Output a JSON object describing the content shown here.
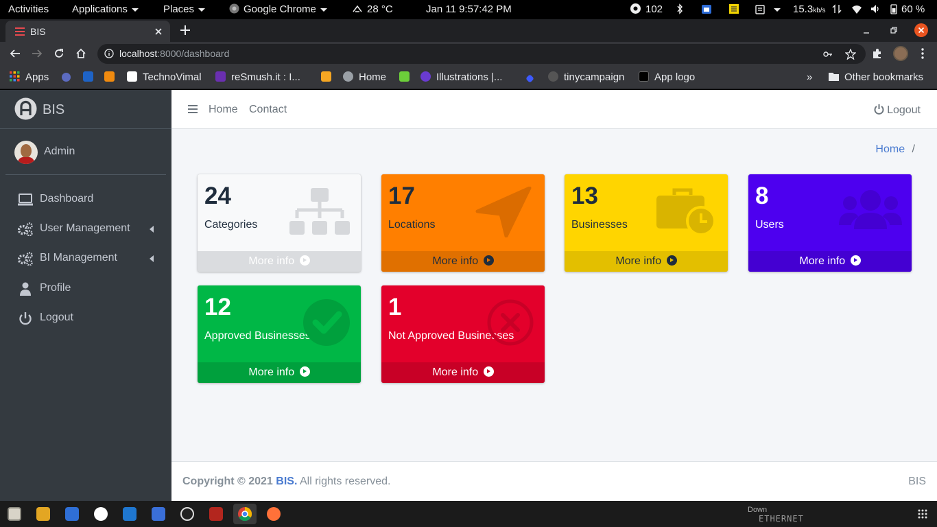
{
  "system_bar": {
    "activities": "Activities",
    "applications": "Applications",
    "places": "Places",
    "active_app": "Google Chrome",
    "weather": "28 °C",
    "datetime": "Jan 11   9:57:42 PM",
    "notifications_count": "102",
    "network_speed": "15.3",
    "network_unit": "kb/s",
    "battery": "60 %"
  },
  "browser": {
    "tab_title": "BIS",
    "url_host": "localhost",
    "url_rest": ":8000/dashboard",
    "bookmarks": {
      "apps": "Apps",
      "items": [
        "TechnoVimal",
        "reSmush.it : I...",
        "Home",
        "Illustrations |...",
        "tinycampaign",
        "App logo"
      ],
      "more": "»",
      "other": "Other bookmarks"
    }
  },
  "sidebar": {
    "brand": "BIS",
    "user": "Admin",
    "items": [
      {
        "label": "Dashboard",
        "icon": "laptop-icon"
      },
      {
        "label": "User Management",
        "icon": "cogs-icon"
      },
      {
        "label": "BI Management",
        "icon": "cogs-icon"
      },
      {
        "label": "Profile",
        "icon": "user-icon"
      },
      {
        "label": "Logout",
        "icon": "power-icon"
      }
    ]
  },
  "header": {
    "nav": [
      "Home",
      "Contact"
    ],
    "logout": "Logout"
  },
  "breadcrumb": {
    "home": "Home",
    "sep": "/"
  },
  "stats": [
    {
      "count": "24",
      "label": "Categories",
      "more": "More info",
      "color": "#f8f9fa",
      "icon": "sitemap-icon"
    },
    {
      "count": "17",
      "label": "Locations",
      "more": "More info",
      "color": "#ff7f00",
      "icon": "location-arrow-icon"
    },
    {
      "count": "13",
      "label": "Businesses",
      "more": "More info",
      "color": "#ffd500",
      "icon": "business-time-icon"
    },
    {
      "count": "8",
      "label": "Users",
      "more": "More info",
      "color": "#4d00ef",
      "icon": "users-icon"
    },
    {
      "count": "12",
      "label": "Approved Businesses",
      "more": "More info",
      "color": "#00b746",
      "icon": "check-circle-icon"
    },
    {
      "count": "1",
      "label": "Not Approved Businesses",
      "more": "More info",
      "color": "#e3002b",
      "icon": "times-circle-icon"
    }
  ],
  "footer": {
    "copyright": "Copyright © 2021",
    "brand": "BIS.",
    "rights": "All rights reserved.",
    "right": "BIS"
  },
  "desktop": {
    "network_label": "ETHERNET",
    "down": "Down"
  }
}
